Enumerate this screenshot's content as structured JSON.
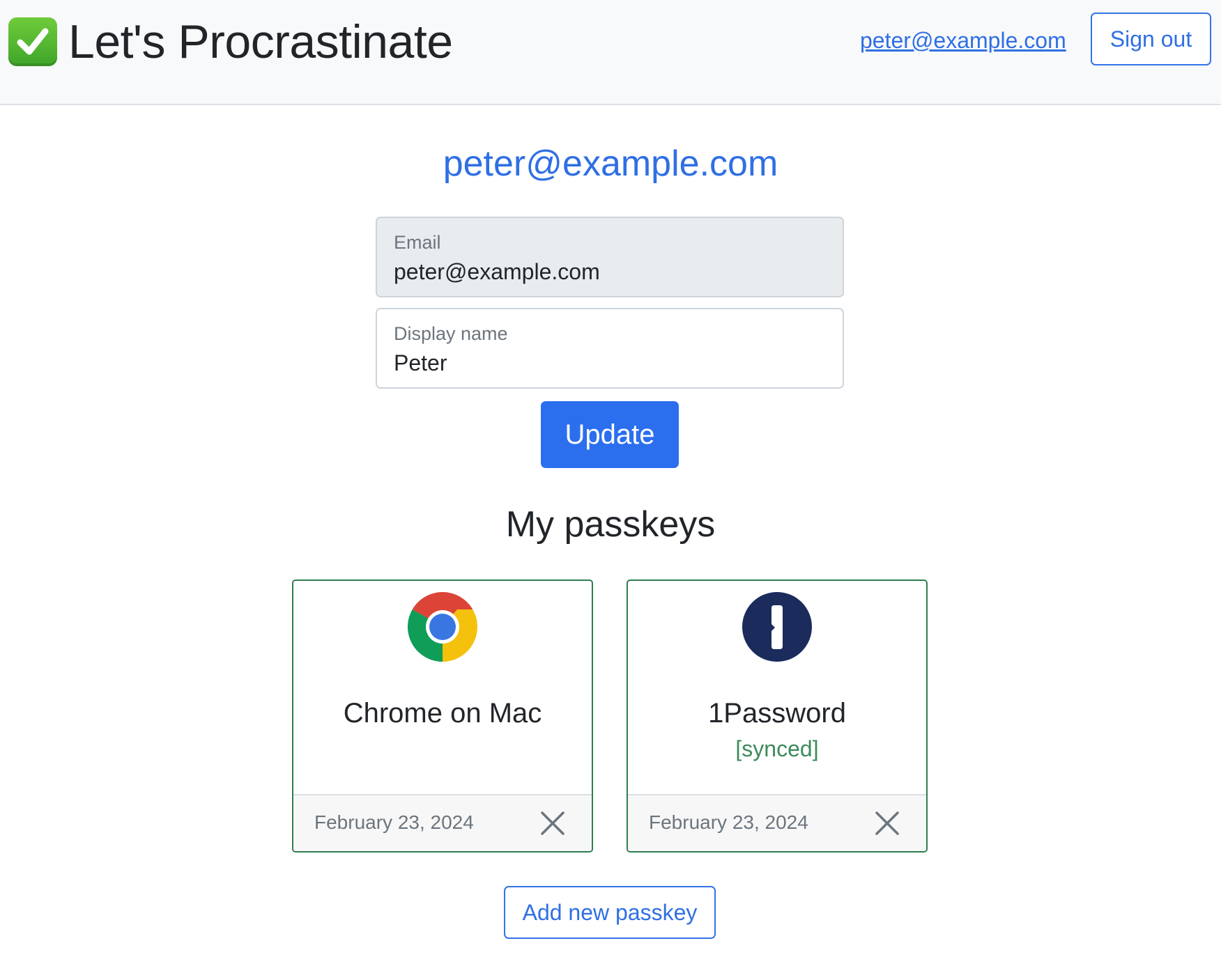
{
  "header": {
    "brand_icon": "check-mark-button-emoji",
    "title": "Let's Procrastinate",
    "user_email": "peter@example.com",
    "signout_label": "Sign out"
  },
  "main": {
    "heading": "peter@example.com",
    "form": {
      "email": {
        "label": "Email",
        "value": "peter@example.com",
        "readonly": true
      },
      "display_name": {
        "label": "Display name",
        "value": "Peter"
      },
      "update_label": "Update"
    },
    "passkeys": {
      "heading": "My passkeys",
      "items": [
        {
          "icon": "chrome-icon",
          "name": "Chrome on Mac",
          "status": "",
          "date": "February 23, 2024",
          "delete_icon": "close-icon"
        },
        {
          "icon": "1password-icon",
          "name": "1Password",
          "status": "[synced]",
          "date": "February 23, 2024",
          "delete_icon": "close-icon"
        }
      ],
      "add_label": "Add new passkey"
    }
  },
  "colors": {
    "primary": "#2b6fef",
    "link": "#2f6fe4",
    "card_border": "#2e7d4f",
    "synced": "#3d8a5a",
    "navbar_bg": "#f8f9fa",
    "readonly_bg": "#e9ecef",
    "onepassword_navy": "#1a2b5c"
  }
}
